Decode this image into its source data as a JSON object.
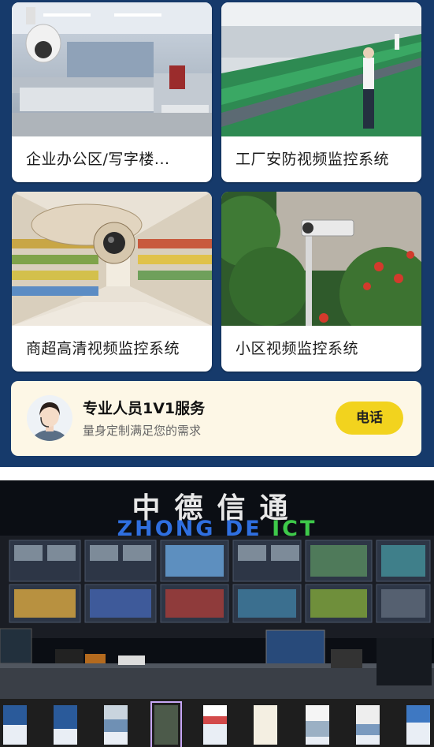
{
  "cards": [
    {
      "label": "企业办公区/写字楼..."
    },
    {
      "label": "工厂安防视频监控系统"
    },
    {
      "label": "商超高清视频监控系统"
    },
    {
      "label": "小区视频监控系统"
    }
  ],
  "service": {
    "title": "专业人员1V1服务",
    "subtitle": "量身定制满足您的需求",
    "call_label": "电话"
  },
  "banner": {
    "title": "中德信通",
    "subtitle_part1": "ZHONG DE ",
    "subtitle_part2": "ICT"
  },
  "thumbnails": {
    "count": 9,
    "selected_index": 3
  },
  "colors": {
    "panel_bg": "#163a6b",
    "service_bg": "#fdf7e6",
    "call_button": "#f2d31e"
  }
}
